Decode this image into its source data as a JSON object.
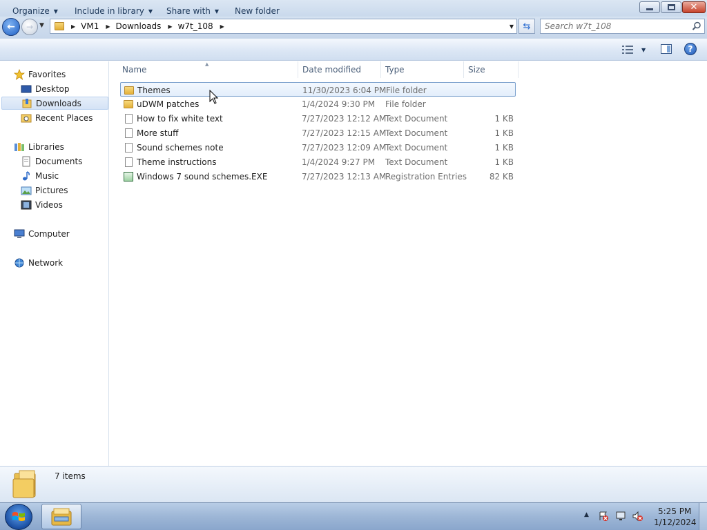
{
  "window": {
    "address": {
      "crumbs": [
        "VM1",
        "Downloads",
        "w7t_108"
      ]
    },
    "search": {
      "placeholder": "Search w7t_108"
    }
  },
  "toolbar": {
    "organize": "Organize",
    "include_in_library": "Include in library",
    "share_with": "Share with",
    "new_folder": "New folder"
  },
  "nav": {
    "favorites": "Favorites",
    "desktop": "Desktop",
    "downloads": "Downloads",
    "recent_places": "Recent Places",
    "libraries": "Libraries",
    "documents": "Documents",
    "music": "Music",
    "pictures": "Pictures",
    "videos": "Videos",
    "computer": "Computer",
    "network": "Network"
  },
  "columns": {
    "name": "Name",
    "date_modified": "Date modified",
    "type": "Type",
    "size": "Size"
  },
  "files": [
    {
      "name": "Themes",
      "date": "11/30/2023 6:04 PM",
      "type": "File folder",
      "size": "",
      "icon": "folder-icon"
    },
    {
      "name": "uDWM patches",
      "date": "1/4/2024 9:30 PM",
      "type": "File folder",
      "size": "",
      "icon": "folder-icon"
    },
    {
      "name": "How to fix white text",
      "date": "7/27/2023 12:12 AM",
      "type": "Text Document",
      "size": "1 KB",
      "icon": "text-document-icon"
    },
    {
      "name": "More stuff",
      "date": "7/27/2023 12:15 AM",
      "type": "Text Document",
      "size": "1 KB",
      "icon": "text-document-icon"
    },
    {
      "name": "Sound schemes note",
      "date": "7/27/2023 12:09 AM",
      "type": "Text Document",
      "size": "1 KB",
      "icon": "text-document-icon"
    },
    {
      "name": "Theme instructions",
      "date": "1/4/2024 9:27 PM",
      "type": "Text Document",
      "size": "1 KB",
      "icon": "text-document-icon"
    },
    {
      "name": "Windows 7 sound schemes.EXE",
      "date": "7/27/2023 12:13 AM",
      "type": "Registration Entries",
      "size": "82 KB",
      "icon": "registry-file-icon"
    }
  ],
  "details": {
    "items_count": "7 items"
  },
  "taskbar": {
    "time": "5:25 PM",
    "date": "1/12/2024"
  },
  "colors": {
    "accent": "#1e395b",
    "selection_border": "#7da2ce",
    "selection_fill": "#e3eefb"
  }
}
